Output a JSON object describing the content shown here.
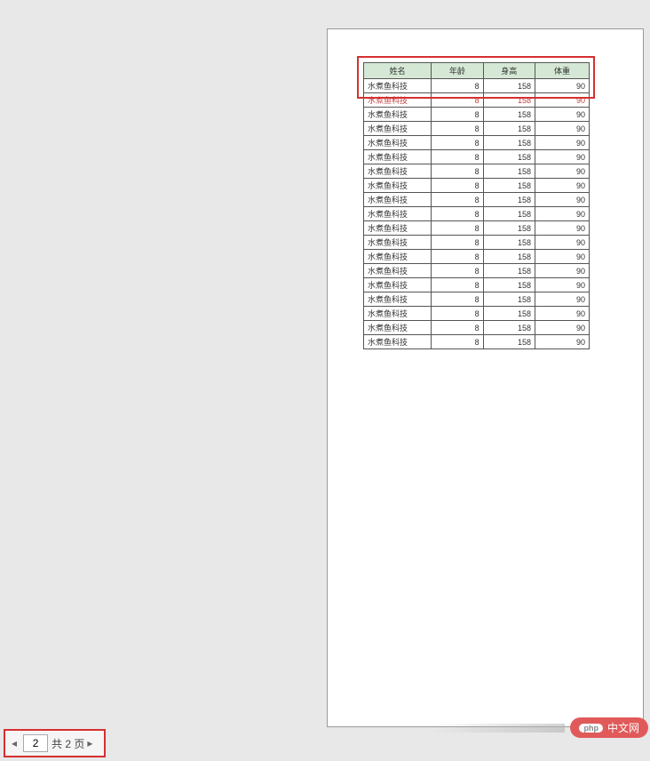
{
  "table": {
    "headers": {
      "name": "姓名",
      "age": "年龄",
      "height": "身高",
      "weight": "体重"
    },
    "row": {
      "name": "水煮鱼科技",
      "age": "8",
      "height": "158",
      "weight": "90"
    },
    "row_count": 19
  },
  "pagination": {
    "current": "2",
    "total_label": "共 2 页"
  },
  "watermark": {
    "php": "php",
    "site": "中文网"
  }
}
